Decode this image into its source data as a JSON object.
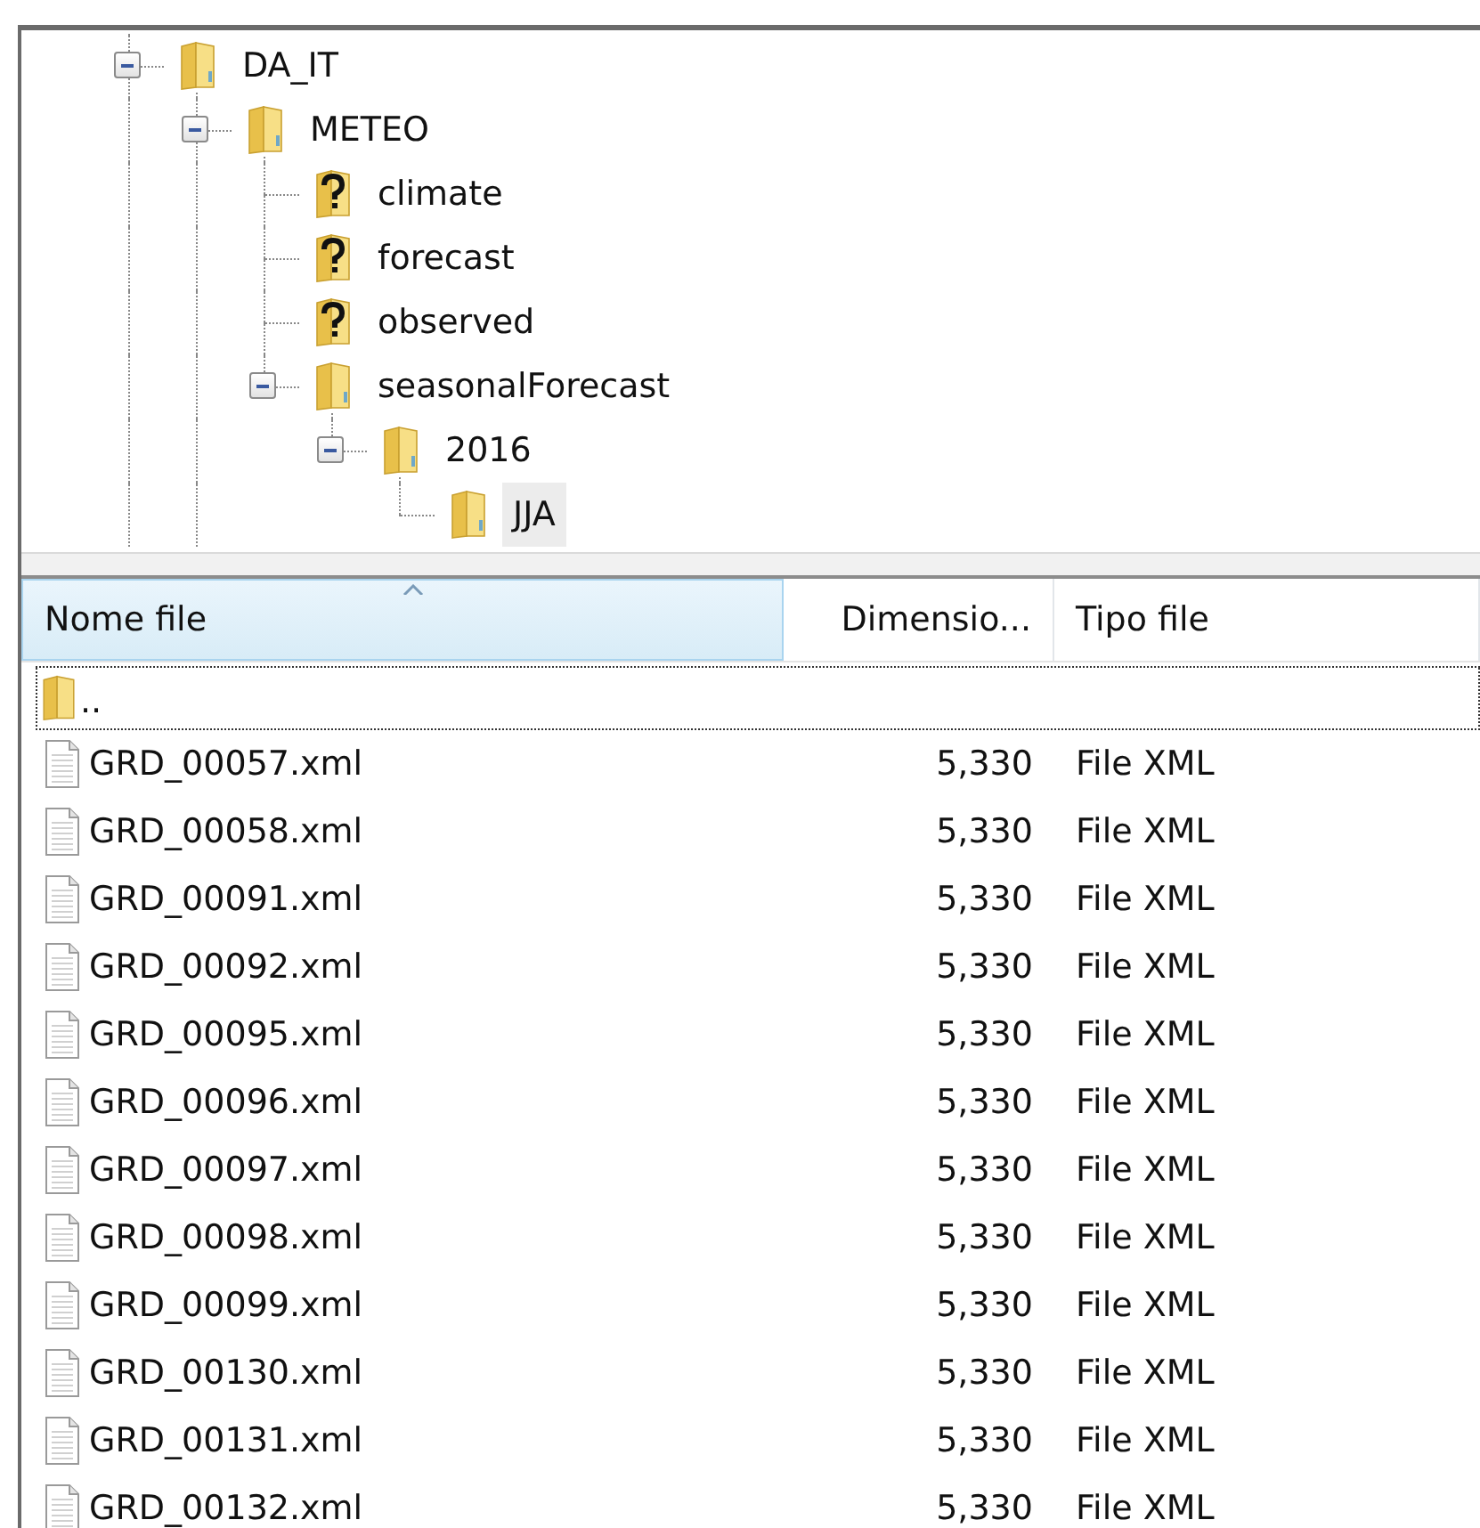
{
  "tree": [
    {
      "label": "DA_IT",
      "kind": "folder",
      "expanded": true,
      "more_below": true,
      "selected": false,
      "children": [
        {
          "label": "METEO",
          "kind": "folder",
          "expanded": true,
          "more_below": true,
          "selected": false,
          "children": [
            {
              "label": "climate",
              "kind": "unknown",
              "expanded": false,
              "selected": false
            },
            {
              "label": "forecast",
              "kind": "unknown",
              "expanded": false,
              "selected": false
            },
            {
              "label": "observed",
              "kind": "unknown",
              "expanded": false,
              "selected": false
            },
            {
              "label": "seasonalForecast",
              "kind": "folder",
              "expanded": true,
              "selected": false,
              "children": [
                {
                  "label": "2016",
                  "kind": "folder",
                  "expanded": true,
                  "selected": false,
                  "children": [
                    {
                      "label": "JJA",
                      "kind": "folder",
                      "expanded": false,
                      "selected": true
                    }
                  ]
                }
              ]
            }
          ]
        }
      ]
    }
  ],
  "file_list": {
    "columns": [
      {
        "label": "Nome file",
        "sorted": true
      },
      {
        "label": "Dimensio...",
        "sorted": false
      },
      {
        "label": "Tipo file",
        "sorted": false
      }
    ],
    "parent_row": {
      "label": "..",
      "focused": true
    },
    "rows": [
      {
        "name": "GRD_00057.xml",
        "size": "5,330",
        "type": "File XML"
      },
      {
        "name": "GRD_00058.xml",
        "size": "5,330",
        "type": "File XML"
      },
      {
        "name": "GRD_00091.xml",
        "size": "5,330",
        "type": "File XML"
      },
      {
        "name": "GRD_00092.xml",
        "size": "5,330",
        "type": "File XML"
      },
      {
        "name": "GRD_00095.xml",
        "size": "5,330",
        "type": "File XML"
      },
      {
        "name": "GRD_00096.xml",
        "size": "5,330",
        "type": "File XML"
      },
      {
        "name": "GRD_00097.xml",
        "size": "5,330",
        "type": "File XML"
      },
      {
        "name": "GRD_00098.xml",
        "size": "5,330",
        "type": "File XML"
      },
      {
        "name": "GRD_00099.xml",
        "size": "5,330",
        "type": "File XML"
      },
      {
        "name": "GRD_00130.xml",
        "size": "5,330",
        "type": "File XML"
      },
      {
        "name": "GRD_00131.xml",
        "size": "5,330",
        "type": "File XML"
      },
      {
        "name": "GRD_00132.xml",
        "size": "5,330",
        "type": "File XML"
      }
    ]
  }
}
